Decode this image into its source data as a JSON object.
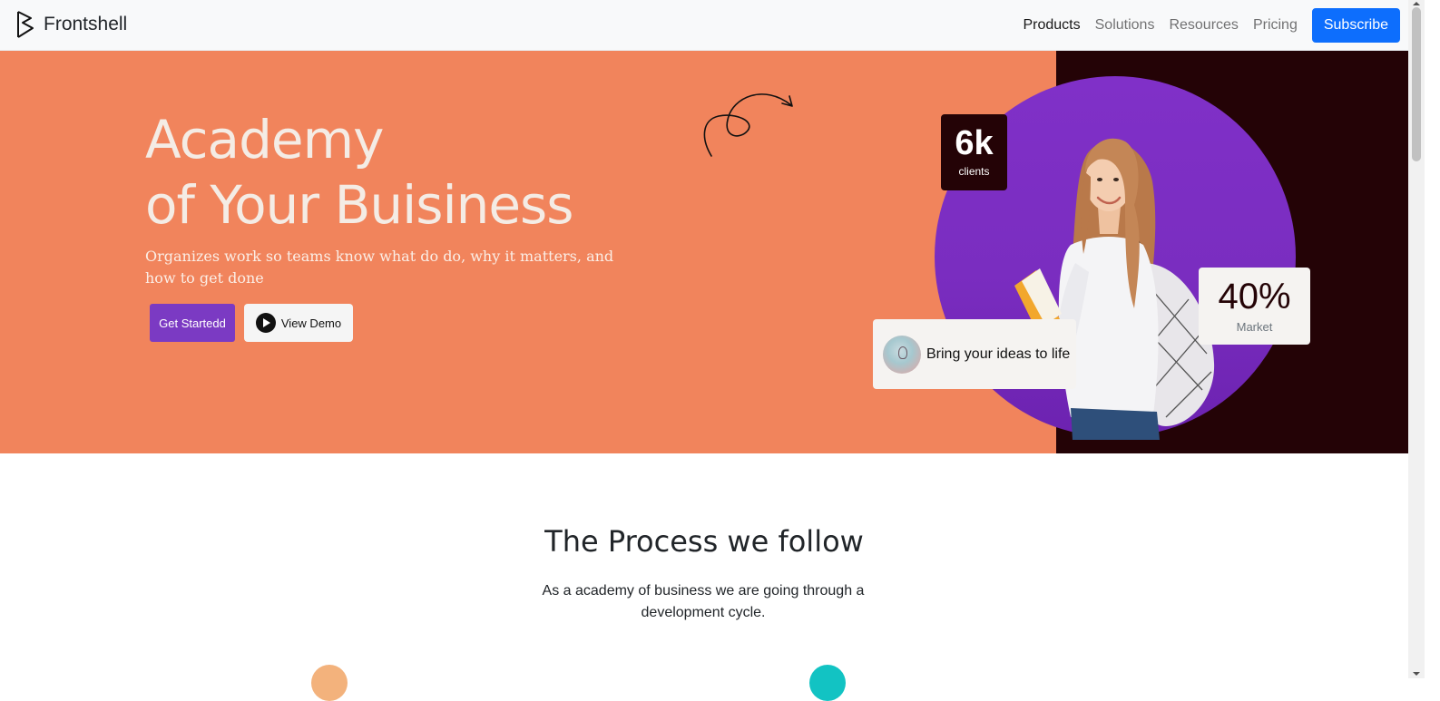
{
  "navbar": {
    "brand": "Frontshell",
    "links": [
      {
        "label": "Products",
        "active": true
      },
      {
        "label": "Solutions",
        "active": false
      },
      {
        "label": "Resources",
        "active": false
      },
      {
        "label": "Pricing",
        "active": false
      }
    ],
    "subscribe_label": "Subscribe"
  },
  "hero": {
    "title_line1": "Academy",
    "title_line2": "of Your Buisiness",
    "subtitle": "Organizes work so teams know what do do, why it matters, and how to get done",
    "cta_primary": "Get Startedd",
    "cta_secondary": "View Demo",
    "stat_clients": {
      "value": "6k",
      "label": "clients"
    },
    "stat_market": {
      "value": "40%",
      "label": "Market"
    },
    "ideas_card": "Bring your ideas to life"
  },
  "process": {
    "title": "The Process we follow",
    "subtitle": "As a academy of business we are going through a development cycle."
  },
  "colors": {
    "hero_bg": "#f1845c",
    "hero_dark": "#240306",
    "purple": "#7b3ac3",
    "primary": "#0d6efd"
  },
  "icons": [
    "brand-logo-icon",
    "play-icon",
    "arrow-doodle-icon",
    "lightbulb-icon"
  ]
}
